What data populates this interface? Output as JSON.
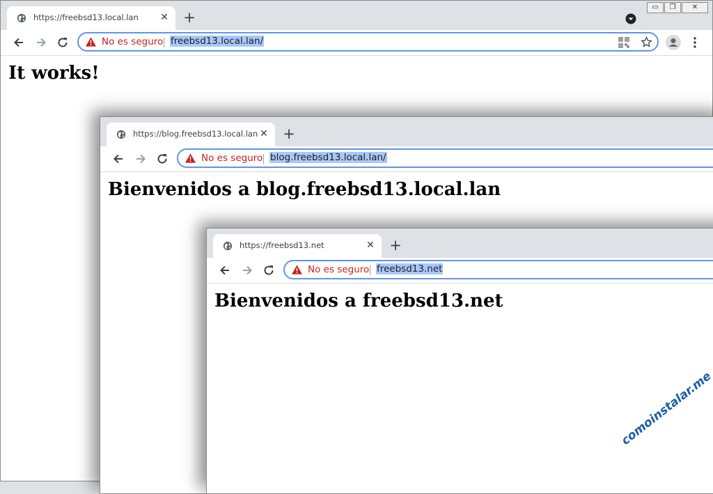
{
  "windows": [
    {
      "tab_title": "https://freebsd13.local.lan",
      "security_label": "No es seguro",
      "url": "freebsd13.local.lan/",
      "heading": "It works!"
    },
    {
      "tab_title": "https://blog.freebsd13.local.lan",
      "security_label": "No es seguro",
      "url": "blog.freebsd13.local.lan/",
      "heading": "Bienvenidos a blog.freebsd13.local.lan"
    },
    {
      "tab_title": "https://freebsd13.net",
      "security_label": "No es seguro",
      "url": "freebsd13.net",
      "heading": "Bienvenidos a freebsd13.net"
    }
  ],
  "icons": {
    "back": "back-arrow-icon",
    "forward": "forward-arrow-icon",
    "reload": "reload-icon",
    "close_tab": "close-icon",
    "new_tab": "plus-icon",
    "warning": "warning-icon",
    "globe": "globe-icon"
  },
  "colors": {
    "insecure": "#c5221f",
    "omnibox_focus": "#5f95e8",
    "selection": "#a8c7fa",
    "watermark": "#1e5ea8"
  },
  "watermark": "comoinstalar.me"
}
